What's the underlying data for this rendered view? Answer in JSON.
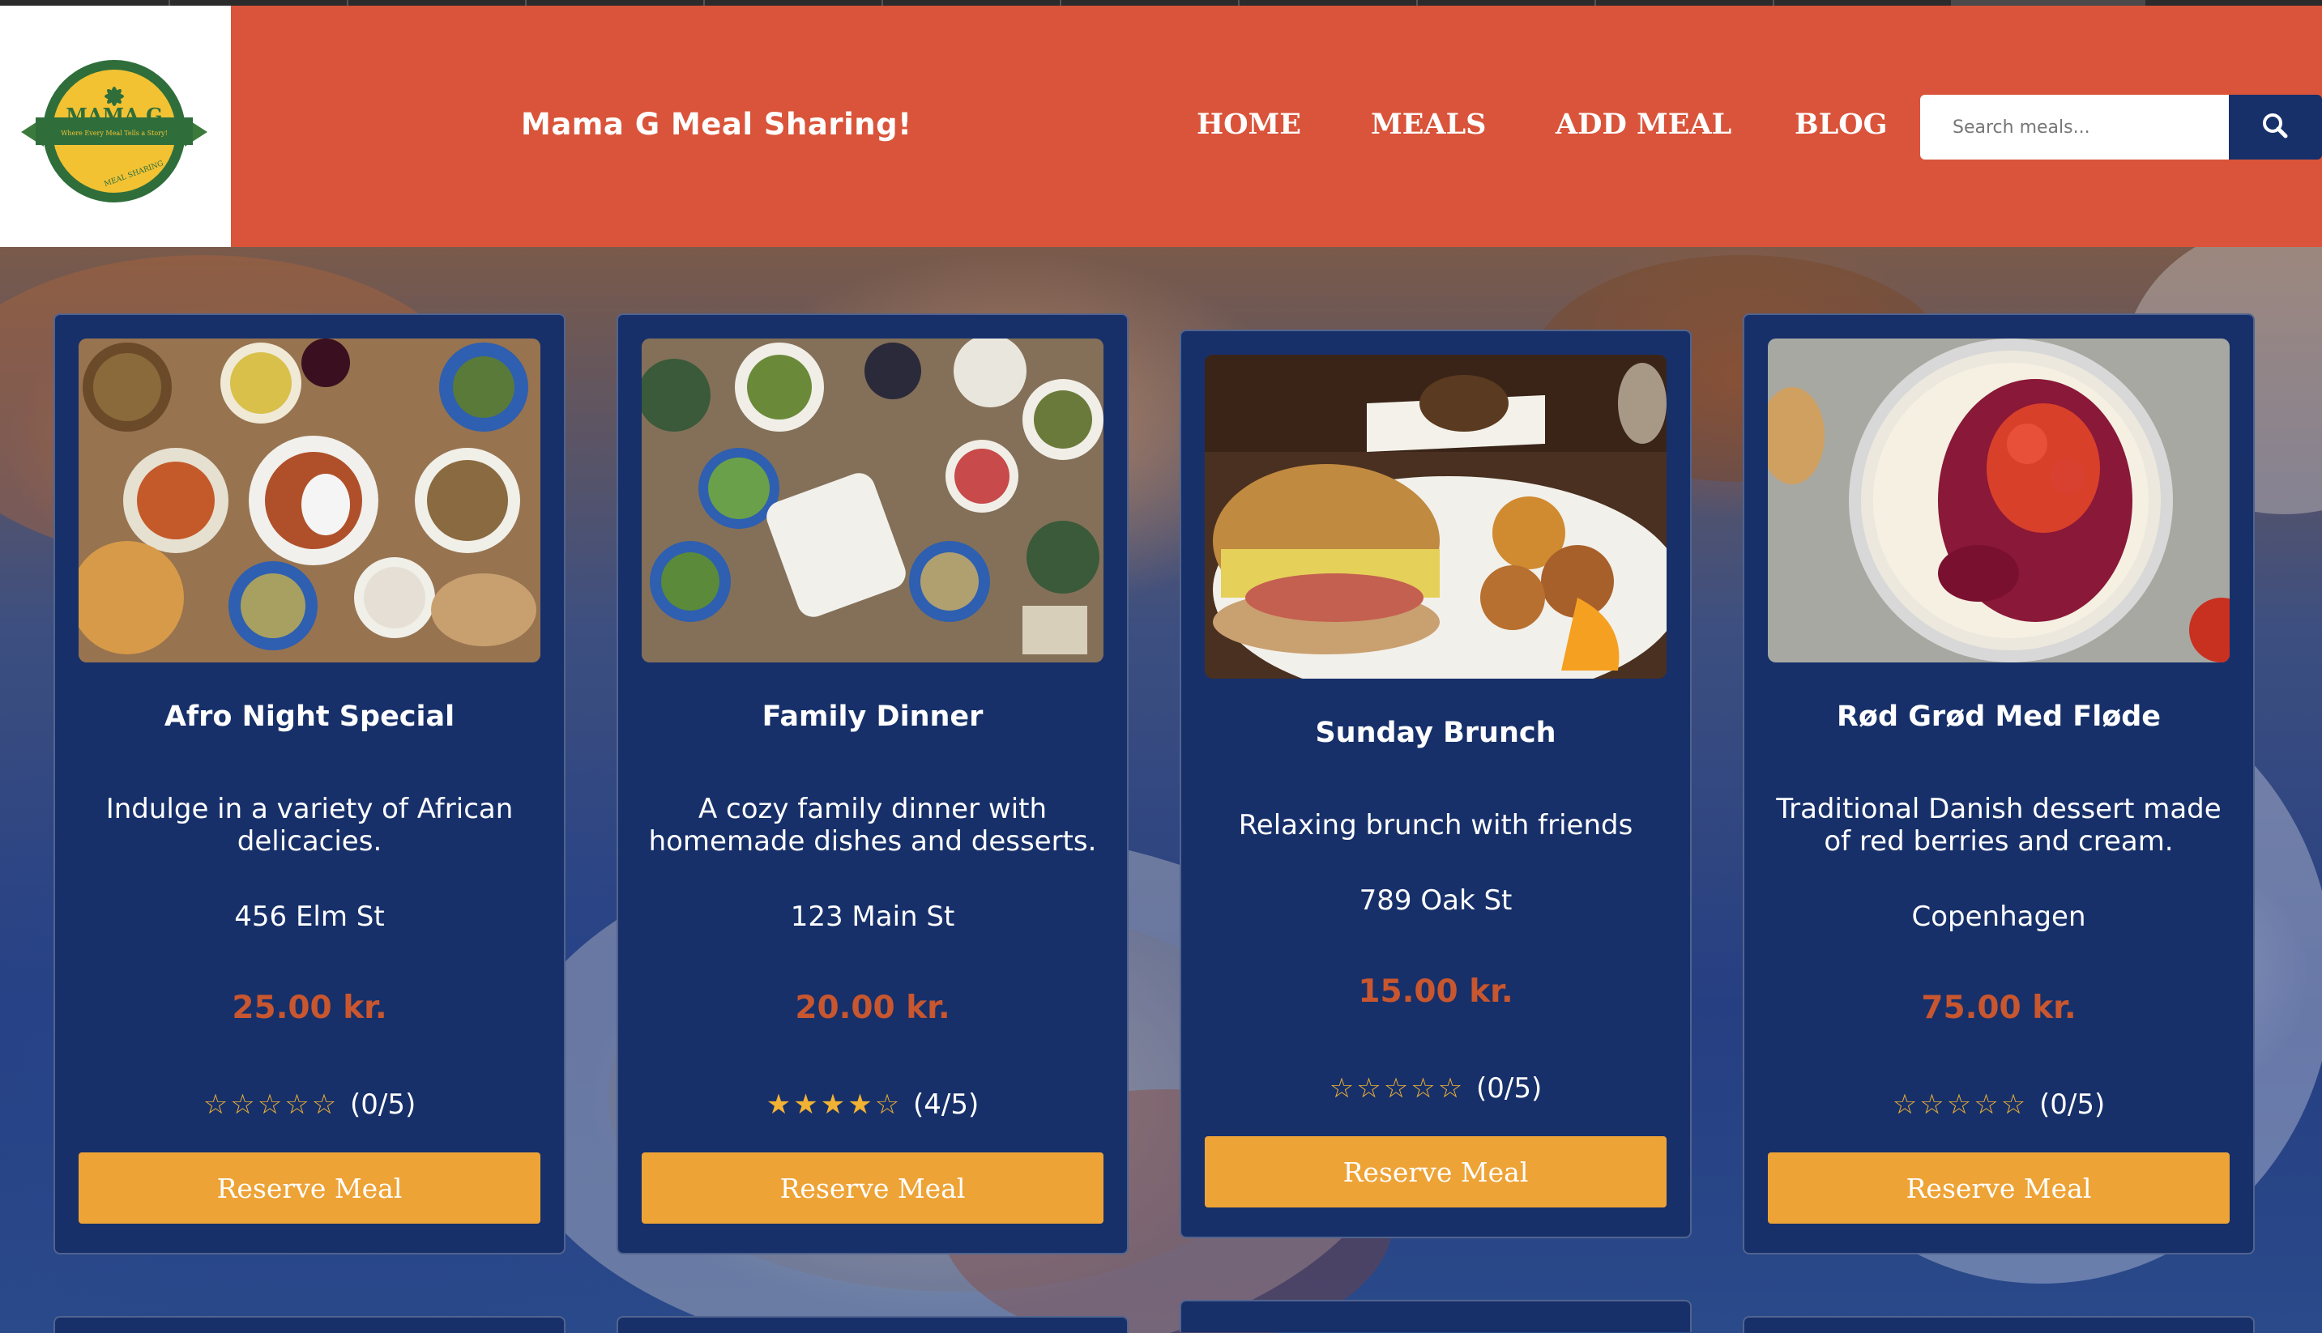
{
  "header": {
    "logo": {
      "name": "MAMA G",
      "tagline": "Where Every Meal Tells a Story!",
      "subtext": "MEAL SHARING"
    },
    "site_title": "Mama G Meal Sharing!",
    "nav": [
      "HOME",
      "MEALS",
      "ADD MEAL",
      "BLOG"
    ],
    "search": {
      "placeholder": "Search meals..."
    }
  },
  "meals": [
    {
      "title": "Afro Night Special",
      "description": "Indulge in a variety of African delicacies.",
      "location": "456 Elm St",
      "price": "25.00 kr.",
      "rating": 0,
      "rating_text": "(0/5)",
      "button": "Reserve Meal"
    },
    {
      "title": "Family Dinner",
      "description": "A cozy family dinner with homemade dishes and desserts.",
      "location": "123 Main St",
      "price": "20.00 kr.",
      "rating": 4,
      "rating_text": "(4/5)",
      "button": "Reserve Meal"
    },
    {
      "title": "Sunday Brunch",
      "description": "Relaxing brunch with friends",
      "location": "789 Oak St",
      "price": "15.00 kr.",
      "rating": 0,
      "rating_text": "(0/5)",
      "button": "Reserve Meal"
    },
    {
      "title": "Rød Grød Med Fløde",
      "description": "Traditional Danish dessert made of red berries and cream.",
      "location": "Copenhagen",
      "price": "75.00 kr.",
      "rating": 0,
      "rating_text": "(0/5)",
      "button": "Reserve Meal"
    }
  ],
  "colors": {
    "header_bg": "#d9543a",
    "card_bg": "#17306a",
    "price": "#c8562f",
    "button": "#eea336",
    "star": "#f2b233"
  },
  "icons": {
    "search_button": "search-icon"
  }
}
